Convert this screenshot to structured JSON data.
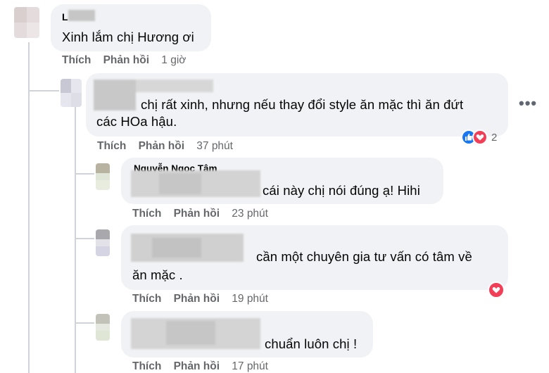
{
  "comments": [
    {
      "author": "L",
      "text": "Xinh lắm chị Hương ơi",
      "like_label": "Thích",
      "reply_label": "Phản hồi",
      "time": "1 giờ"
    },
    {
      "author": "",
      "text_line1": "chị rất xinh, nhưng nếu thay đổi style ăn mặc thì ăn đứt",
      "text_line2": "các HOa hậu.",
      "like_label": "Thích",
      "reply_label": "Phản hồi",
      "time": "37 phút",
      "reaction_count": "2",
      "reaction_icons": [
        "like-icon",
        "love-icon"
      ]
    },
    {
      "author": "Nguyễn Ngọc Tâm",
      "text": "cái này chị nói đúng ạ! Hihi",
      "like_label": "Thích",
      "reply_label": "Phản hồi",
      "time": "23 phút"
    },
    {
      "author": "",
      "text_line1": "cần một chuyên gia tư vấn có tâm về",
      "text_line2": "ăn mặc .",
      "like_label": "Thích",
      "reply_label": "Phản hồi",
      "time": "19 phút",
      "reaction_icons": [
        "love-icon"
      ]
    },
    {
      "author": "",
      "text": "chuẩn luôn chị !",
      "like_label": "Thích",
      "reply_label": "Phản hồi",
      "time": "17 phút"
    }
  ],
  "more_options": "•••",
  "colors": {
    "bubble": "#f0f2f5",
    "meta": "#65676b",
    "like": "#1877f2",
    "love": "#f33e58"
  }
}
